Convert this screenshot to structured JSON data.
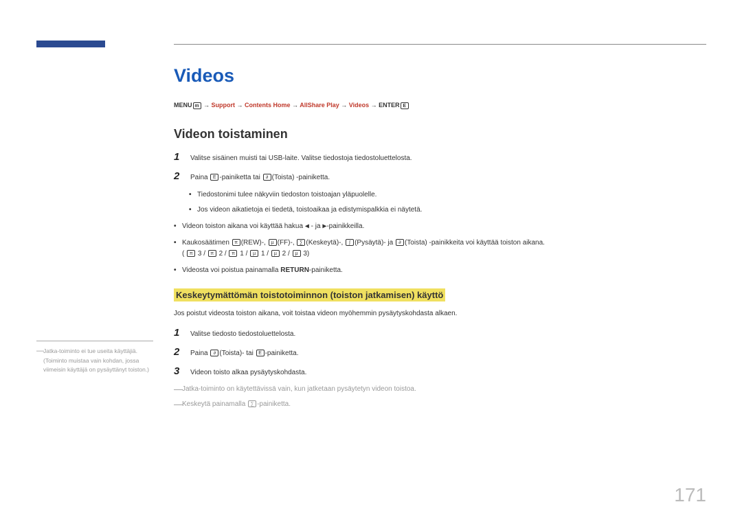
{
  "title": "Videos",
  "breadcrumb": {
    "menu": "MENU",
    "support": "Support",
    "contents_home": "Contents Home",
    "allshare": "AllShare Play",
    "videos": "Videos",
    "enter": "ENTER",
    "arrow": " → "
  },
  "subtitle": "Videon toistaminen",
  "steps1": {
    "s1": "Valitse sisäinen muisti tai USB-laite. Valitse tiedostoja tiedostoluettelosta.",
    "s2a": "Paina ",
    "s2b": "-painiketta tai ",
    "s2c": "(Toista) -painiketta."
  },
  "bullets_inner": {
    "b1": "Tiedostonimi tulee näkyviin tiedoston toistoajan yläpuolelle.",
    "b2": "Jos videon aikatietoja ei tiedetä, toistoaikaa ja edistymispalkkia ei näytetä."
  },
  "bullets_outer": {
    "b1a": "Videon toiston aikana voi käyttää hakua ",
    "b1b": " - ja ",
    "b1c": "-painikkeilla.",
    "b2a": "Kaukosäätimen ",
    "b2b": "(REW)-, ",
    "b2c": "(FF)-, ",
    "b2d": "(Keskeytä)-, ",
    "b2e": "(Pysäytä)- ja ",
    "b2f": "(Toista) -painikkeita voi käyttää toiston aikana.",
    "b2g": "( ",
    "b2h": " 3 / ",
    "b2i": " 2 / ",
    "b2j": " 1 / ",
    "b2k": " 1 / ",
    "b2l": " 2 / ",
    "b2m": " 3)",
    "b3a": "Videosta voi poistua painamalla ",
    "b3b": "RETURN",
    "b3c": "-painiketta."
  },
  "highlight": "Keskeytymättömän toistotoiminnon (toiston jatkamisen) käyttö",
  "para2": "Jos poistut videosta toiston aikana, voit toistaa videon myöhemmin pysäytyskohdasta alkaen.",
  "steps2": {
    "s1": "Valitse tiedosto tiedostoluettelosta.",
    "s2a": "Paina ",
    "s2b": "(Toista)- tai ",
    "s2c": "-painiketta.",
    "s3": "Videon toisto alkaa pysäytyskohdasta."
  },
  "notes": {
    "n1": "Jatka-toiminto on käytettävissä vain, kun jatketaan pysäytetyn videon toistoa.",
    "n2a": "Keskeytä painamalla ",
    "n2b": "-painiketta."
  },
  "sidebar": {
    "text": "Jatka-toiminto ei tue useita käyttäjiä. (Toiminto muistaa vain kohdan, jossa viimeisin käyttäjä on pysäyttänyt toiston.)"
  },
  "icons": {
    "menu": "m",
    "enter": "E",
    "play": "∂",
    "rew": "π",
    "ff": "µ",
    "pause": "∑",
    "stop": "∫",
    "left": "◀",
    "right": "▶"
  },
  "pagenum": "171"
}
